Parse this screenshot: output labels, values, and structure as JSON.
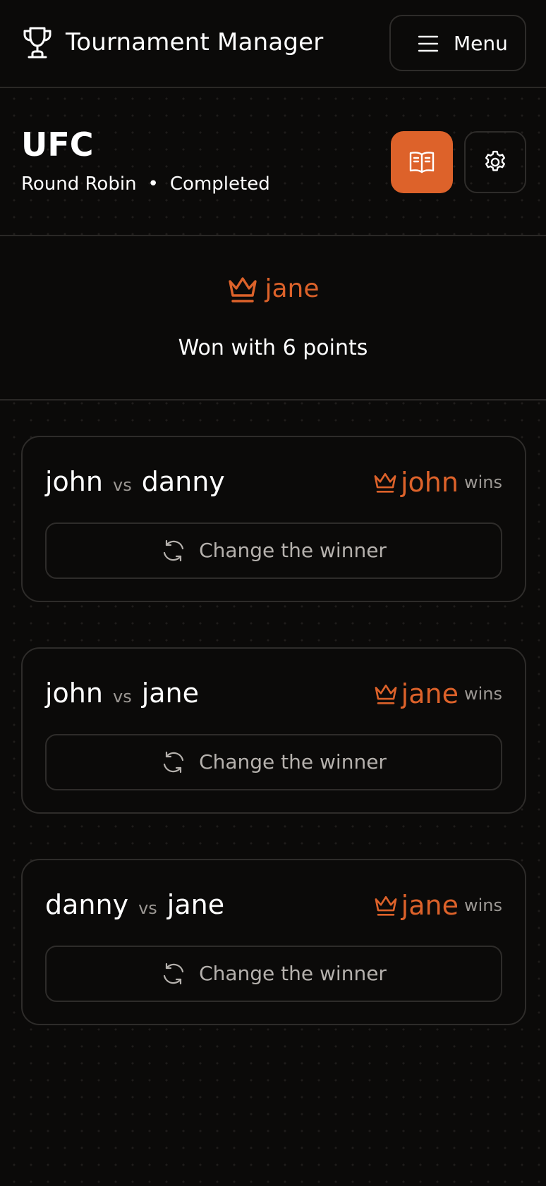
{
  "header": {
    "app_title": "Tournament Manager",
    "menu_label": "Menu"
  },
  "tournament": {
    "name": "UFC",
    "format": "Round Robin",
    "separator": "•",
    "status": "Completed"
  },
  "winner": {
    "name": "jane",
    "summary": "Won with 6 points"
  },
  "matches": [
    {
      "player1": "john",
      "vs": "vs",
      "player2": "danny",
      "winner": "john",
      "wins_label": "wins",
      "change_label": "Change the winner"
    },
    {
      "player1": "john",
      "vs": "vs",
      "player2": "jane",
      "winner": "jane",
      "wins_label": "wins",
      "change_label": "Change the winner"
    },
    {
      "player1": "danny",
      "vs": "vs",
      "player2": "jane",
      "winner": "jane",
      "wins_label": "wins",
      "change_label": "Change the winner"
    }
  ],
  "icons": {
    "brand": "trophy-icon",
    "menu": "hamburger-icon",
    "rules": "book-open-icon",
    "settings": "gear-icon",
    "winner": "crown-icon",
    "change": "refresh-icon"
  },
  "colors": {
    "background": "#0b0a09",
    "accent": "#dd622a",
    "border": "#2e2c2a",
    "muted_text": "#9c9894"
  }
}
